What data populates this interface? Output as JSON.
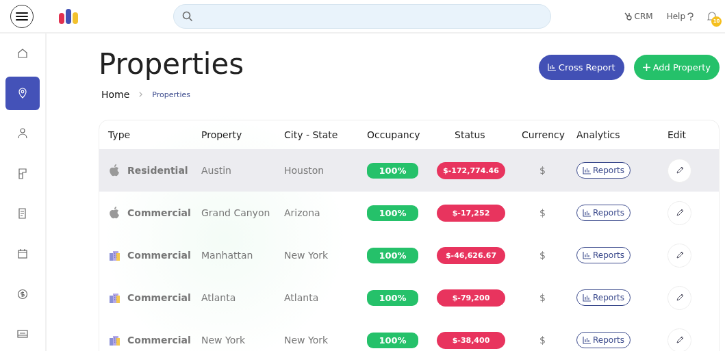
{
  "topbar": {
    "links": [
      {
        "label": "CRM",
        "kind": "crm"
      },
      {
        "label": "Help",
        "kind": "help"
      }
    ],
    "notifications": {
      "count": "10"
    }
  },
  "sidebar": {
    "items": [
      {
        "kind": "home",
        "selected": false
      },
      {
        "kind": "pin",
        "selected": true
      },
      {
        "kind": "person",
        "selected": false
      },
      {
        "kind": "plan",
        "selected": false
      },
      {
        "kind": "document",
        "selected": false
      },
      {
        "kind": "calendar",
        "selected": false
      },
      {
        "kind": "dollar",
        "selected": false
      },
      {
        "kind": "card",
        "selected": false
      }
    ]
  },
  "page": {
    "title": "Properties",
    "breadcrumb": [
      "Home",
      "Properties"
    ],
    "buttons": [
      {
        "label": "Cross Report",
        "kind": "report"
      },
      {
        "label": "Add Property",
        "kind": "add"
      }
    ]
  },
  "table": {
    "columns": [
      "Type",
      "Property",
      "City - State",
      "Occupancy",
      "Status",
      "Currency",
      "Analytics",
      "Edit"
    ],
    "rows": [
      {
        "type": "Residential",
        "kind": "apple",
        "property": "Austin",
        "city": "Houston",
        "occupancy": "100%",
        "status": "$-172,774.46",
        "currency": "$",
        "analytics": "Reports",
        "selected": true
      },
      {
        "type": "Commercial",
        "kind": "apple",
        "property": "Grand Canyon",
        "city": "Arizona",
        "occupancy": "100%",
        "status": "$-17,252",
        "currency": "$",
        "analytics": "Reports",
        "selected": false
      },
      {
        "type": "Commercial",
        "kind": "building",
        "property": "Manhattan",
        "city": "New York",
        "occupancy": "100%",
        "status": "$-46,626.67",
        "currency": "$",
        "analytics": "Reports",
        "selected": false
      },
      {
        "type": "Commercial",
        "kind": "building",
        "property": "Atlanta",
        "city": "Atlanta",
        "occupancy": "100%",
        "status": "$-79,200",
        "currency": "$",
        "analytics": "Reports",
        "selected": false
      },
      {
        "type": "Commercial",
        "kind": "building",
        "property": "New York",
        "city": "New York",
        "occupancy": "100%",
        "status": "$-38,400",
        "currency": "$",
        "analytics": "Reports",
        "selected": false
      }
    ]
  }
}
